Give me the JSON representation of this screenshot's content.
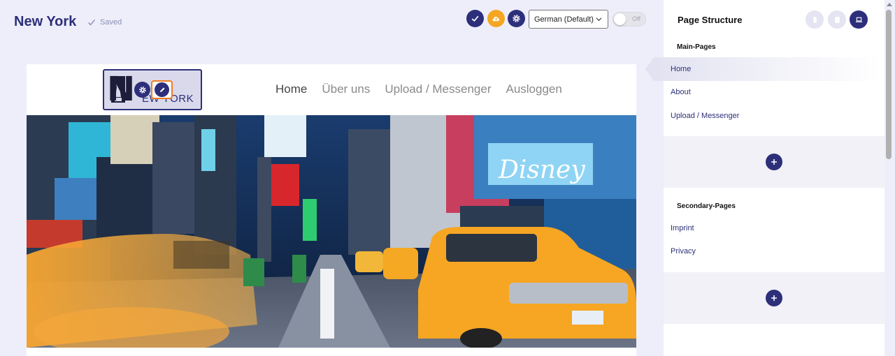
{
  "header": {
    "site_title": "New York",
    "saved_label": "Saved"
  },
  "toolbar": {
    "check_icon": "check-icon",
    "cloud_icon": "cloud-upload-icon",
    "settings_icon": "gear-icon",
    "language_selected": "German (Default)",
    "toggle_label": "Off",
    "accent_color": "#2d2f7a",
    "cloud_color": "#f5a623"
  },
  "preview": {
    "logo_text": "EW YORK",
    "logo_letter": "N",
    "nav": [
      {
        "label": "Home",
        "active": true
      },
      {
        "label": "Über uns",
        "active": false
      },
      {
        "label": "Upload / Messenger",
        "active": false
      },
      {
        "label": "Ausloggen",
        "active": false
      }
    ]
  },
  "panel": {
    "title": "Page Structure",
    "main_pages_label": "Main-Pages",
    "main_pages": [
      "Home",
      "About",
      "Upload / Messenger"
    ],
    "secondary_pages_label": "Secondary-Pages",
    "secondary_pages": [
      "Imprint",
      "Privacy"
    ]
  }
}
